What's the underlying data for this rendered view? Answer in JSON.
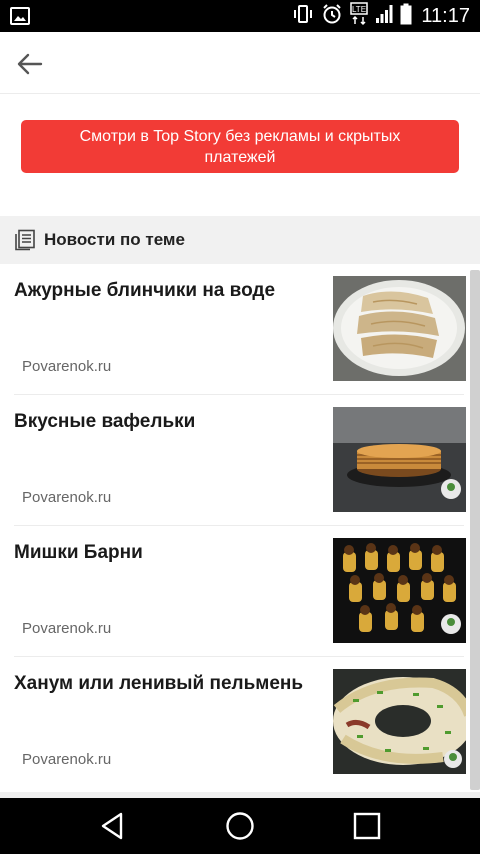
{
  "status_bar": {
    "time": "11:17",
    "network": "LTE",
    "icons": [
      "image-icon",
      "vibrate-icon",
      "alarm-icon",
      "lte-icon",
      "signal-icon",
      "battery-icon"
    ]
  },
  "top_bar": {
    "back_icon": "arrow-left-icon"
  },
  "promo": {
    "text": "Смотри в Top Story без рекламы и скрытых платежей",
    "color": "#f23b36"
  },
  "section": {
    "title": "Новости по теме",
    "icon": "news-icon"
  },
  "articles": [
    {
      "title": "Ажурные блинчики на воде",
      "source": "Povarenok.ru"
    },
    {
      "title": "Вкусные вафельки",
      "source": "Povarenok.ru"
    },
    {
      "title": "Мишки Барни",
      "source": "Povarenok.ru"
    },
    {
      "title": "Ханум или ленивый пельмень",
      "source": "Povarenok.ru"
    }
  ],
  "nav_bar": {
    "icons": [
      "back-triangle-icon",
      "home-circle-icon",
      "recents-square-icon"
    ]
  }
}
